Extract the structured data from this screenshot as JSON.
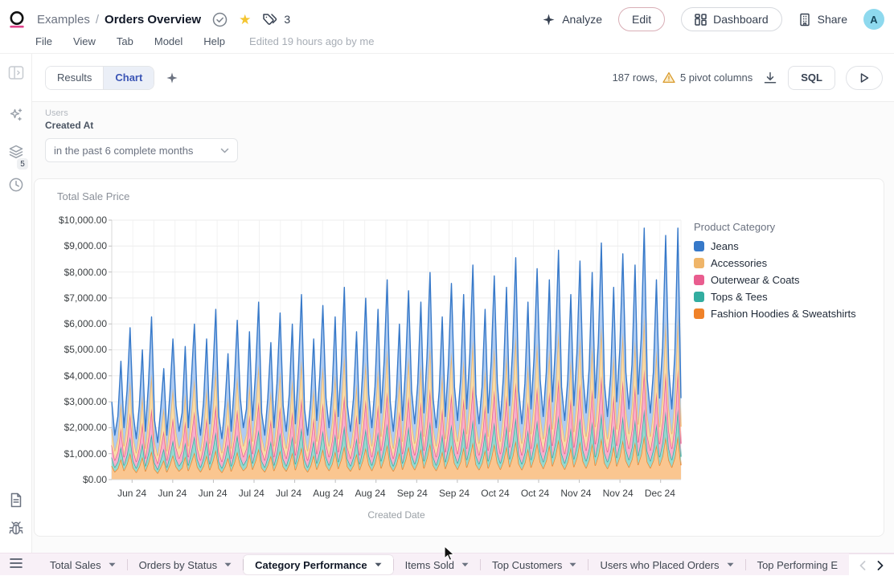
{
  "header": {
    "breadcrumb": {
      "parent": "Examples",
      "separator": "/",
      "title": "Orders Overview"
    },
    "star_glyph": "★",
    "tag_count": "3",
    "actions": {
      "analyze": "Analyze",
      "edit": "Edit",
      "dashboard": "Dashboard",
      "share": "Share"
    },
    "avatar_letter": "A",
    "menus": [
      "File",
      "View",
      "Tab",
      "Model",
      "Help"
    ],
    "edited_note": "Edited 19 hours ago by me"
  },
  "sidebar": {
    "layers_badge": "5"
  },
  "toolbar": {
    "view_tabs": [
      {
        "label": "Results"
      },
      {
        "label": "Chart"
      }
    ],
    "rows_info": "187 rows,",
    "pivot_info": "5 pivot columns",
    "sql_label": "SQL"
  },
  "filter": {
    "group": "Users",
    "field": "Created At",
    "value": "in the past 6 complete months"
  },
  "chart_data": {
    "type": "area",
    "stacked": true,
    "title": "Total Sale Price",
    "xlabel": "Created Date",
    "legend_title": "Product Category",
    "legend_position": "right",
    "grid": true,
    "ylim": [
      0,
      10000
    ],
    "y_tick_step": 1000,
    "y_tick_labels": [
      "$0.00",
      "$1,000.00",
      "$2,000.00",
      "$3,000.00",
      "$4,000.00",
      "$5,000.00",
      "$6,000.00",
      "$7,000.00",
      "$8,000.00",
      "$9,000.00",
      "$10,000.00"
    ],
    "x_tick_labels": [
      "Jun 24",
      "Jun 24",
      "Jun 24",
      "Jul 24",
      "Jul 24",
      "Aug 24",
      "Aug 24",
      "Sep 24",
      "Sep 24",
      "Oct 24",
      "Oct 24",
      "Nov 24",
      "Nov 24",
      "Dec 24"
    ],
    "points": 187,
    "stack_order_bottom_to_top": [
      "Fashion Hoodies & Sweatshirts",
      "Tops & Tees",
      "Outerwear & Coats",
      "Accessories",
      "Jeans"
    ],
    "series": [
      {
        "name": "Jeans",
        "color": "#3779C9",
        "fill": "#AECBF1",
        "values": [
          1050,
          600,
          850,
          1600,
          700,
          1200,
          2050,
          900,
          550,
          1000,
          1750,
          650,
          1300,
          2200,
          800,
          500,
          950,
          1500,
          600,
          1150,
          1900,
          1000,
          650,
          900,
          1800,
          700,
          1350,
          2100,
          950,
          600,
          1050,
          1900,
          750,
          1400,
          2300,
          850,
          550,
          1000,
          1700,
          650,
          1250,
          2150,
          1100,
          700,
          950,
          2000,
          800,
          1450,
          2400,
          900,
          600,
          1100,
          1850,
          700,
          1300,
          2250,
          1000,
          650,
          1150,
          2100,
          750,
          1500,
          2500,
          950,
          600,
          1050,
          1900,
          800,
          1400,
          2350,
          1100,
          700,
          1200,
          2200,
          850,
          1550,
          2600,
          1000,
          650,
          1100,
          2000,
          750,
          1450,
          2450,
          1150,
          700,
          1250,
          2300,
          900,
          1600,
          2700,
          1050,
          650,
          1150,
          2100,
          800,
          1500,
          2550,
          1200,
          750,
          1300,
          2400,
          900,
          1650,
          2800,
          1100,
          700,
          1200,
          2200,
          850,
          1550,
          2650,
          1250,
          800,
          1350,
          2500,
          950,
          1700,
          2900,
          1150,
          750,
          1250,
          2300,
          900,
          1600,
          2750,
          1300,
          800,
          1400,
          2600,
          1000,
          1750,
          3000,
          1200,
          750,
          1300,
          2400,
          950,
          1650,
          2850,
          1350,
          850,
          1450,
          2700,
          1050,
          1800,
          3100,
          1250,
          800,
          1350,
          2500,
          1000,
          1700,
          2950,
          1400,
          900,
          1500,
          2800,
          1100,
          1850,
          3200,
          1300,
          850,
          1400,
          2600,
          1050,
          1750,
          3050,
          1450,
          950,
          1550,
          2900,
          1150,
          1900,
          3400,
          1350,
          900,
          1450,
          2700,
          1100,
          1800,
          3300,
          1500,
          950,
          1700,
          3400,
          1100
        ]
      },
      {
        "name": "Accessories",
        "color": "#EFB569",
        "fill": "#F8DCA8",
        "values": [
          630,
          360,
          510,
          960,
          420,
          720,
          1230,
          540,
          330,
          600,
          1050,
          390,
          780,
          1320,
          480,
          300,
          570,
          900,
          360,
          690,
          1140,
          600,
          390,
          540,
          1080,
          420,
          810,
          1260,
          570,
          360,
          630,
          1140,
          450,
          840,
          1380,
          510,
          330,
          600,
          1020,
          390,
          750,
          1290,
          660,
          420,
          570,
          1200,
          480,
          870,
          1440,
          540,
          360,
          660,
          1110,
          420,
          780,
          1350,
          600,
          390,
          690,
          1260,
          450,
          900,
          1500,
          570,
          360,
          630,
          1140,
          480,
          840,
          1410,
          660,
          420,
          720,
          1320,
          510,
          930,
          1560,
          600,
          390,
          660,
          1200,
          450,
          870,
          1470,
          690,
          420,
          750,
          1380,
          540,
          960,
          1620,
          630,
          390,
          690,
          1260,
          480,
          900,
          1530,
          720,
          450,
          780,
          1440,
          540,
          990,
          1680,
          660,
          420,
          720,
          1320,
          510,
          930,
          1590,
          750,
          480,
          810,
          1500,
          570,
          1020,
          1740,
          690,
          450,
          750,
          1380,
          540,
          960,
          1650,
          780,
          480,
          840,
          1560,
          600,
          1050,
          1800,
          720,
          450,
          780,
          1440,
          570,
          990,
          1710,
          810,
          510,
          870,
          1620,
          630,
          1080,
          1860,
          750,
          480,
          810,
          1500,
          600,
          1020,
          1770,
          840,
          540,
          900,
          1680,
          660,
          1110,
          1920,
          780,
          510,
          840,
          1560,
          630,
          1050,
          1830,
          870,
          570,
          930,
          1740,
          690,
          1140,
          2040,
          810,
          540,
          870,
          1620,
          660,
          1080,
          1980,
          900,
          570,
          1020,
          2040,
          660
        ]
      },
      {
        "name": "Outerwear & Coats",
        "color": "#E95D8F",
        "fill": "#F8AECB",
        "values": [
          470,
          270,
          380,
          720,
          320,
          540,
          920,
          400,
          250,
          450,
          790,
          290,
          590,
          990,
          360,
          230,
          430,
          680,
          270,
          520,
          860,
          450,
          290,
          410,
          810,
          320,
          610,
          950,
          430,
          270,
          470,
          860,
          340,
          630,
          1040,
          380,
          250,
          450,
          770,
          290,
          560,
          970,
          500,
          320,
          430,
          900,
          360,
          650,
          1080,
          410,
          270,
          500,
          830,
          320,
          590,
          1010,
          450,
          290,
          520,
          950,
          340,
          680,
          1130,
          430,
          270,
          470,
          860,
          360,
          630,
          1060,
          500,
          320,
          540,
          990,
          380,
          700,
          1170,
          450,
          290,
          500,
          900,
          340,
          650,
          1100,
          520,
          320,
          560,
          1040,
          410,
          720,
          1220,
          470,
          290,
          520,
          950,
          360,
          680,
          1150,
          540,
          340,
          590,
          1080,
          410,
          740,
          1260,
          500,
          320,
          540,
          990,
          380,
          700,
          1190,
          560,
          360,
          610,
          1130,
          430,
          770,
          1310,
          520,
          340,
          560,
          1040,
          410,
          720,
          1240,
          590,
          360,
          630,
          1170,
          450,
          790,
          1350,
          540,
          340,
          590,
          1080,
          430,
          740,
          1280,
          610,
          380,
          650,
          1220,
          470,
          810,
          1400,
          560,
          360,
          610,
          1130,
          450,
          770,
          1330,
          630,
          410,
          680,
          1260,
          500,
          830,
          1440,
          590,
          380,
          630,
          1170,
          470,
          790,
          1370,
          650,
          430,
          700,
          1310,
          520,
          860,
          1530,
          610,
          410,
          650,
          1220,
          500,
          810,
          1490,
          680,
          430,
          770,
          1530,
          500
        ]
      },
      {
        "name": "Tops & Tees",
        "color": "#33ADA0",
        "fill": "#96D8CE",
        "values": [
          320,
          180,
          260,
          480,
          210,
          360,
          620,
          270,
          170,
          300,
          530,
          200,
          390,
          660,
          240,
          150,
          290,
          450,
          180,
          350,
          570,
          300,
          200,
          270,
          540,
          210,
          410,
          630,
          290,
          180,
          320,
          570,
          230,
          420,
          690,
          260,
          170,
          300,
          510,
          200,
          380,
          650,
          330,
          210,
          290,
          600,
          240,
          440,
          720,
          270,
          180,
          330,
          560,
          210,
          390,
          680,
          300,
          200,
          350,
          630,
          230,
          450,
          750,
          290,
          180,
          320,
          570,
          240,
          420,
          710,
          330,
          210,
          360,
          660,
          260,
          470,
          780,
          300,
          200,
          330,
          600,
          230,
          440,
          740,
          350,
          210,
          380,
          690,
          270,
          480,
          810,
          320,
          200,
          350,
          630,
          240,
          450,
          770,
          360,
          230,
          390,
          720,
          270,
          500,
          840,
          330,
          210,
          360,
          660,
          260,
          470,
          800,
          380,
          240,
          410,
          750,
          290,
          510,
          870,
          350,
          230,
          380,
          690,
          270,
          480,
          830,
          390,
          240,
          420,
          780,
          300,
          530,
          900,
          360,
          230,
          390,
          720,
          290,
          500,
          860,
          410,
          260,
          440,
          810,
          320,
          540,
          930,
          380,
          240,
          410,
          750,
          300,
          510,
          890,
          420,
          270,
          450,
          840,
          330,
          560,
          960,
          390,
          260,
          420,
          780,
          320,
          530,
          920,
          440,
          290,
          470,
          870,
          350,
          570,
          1020,
          410,
          270,
          440,
          810,
          330,
          540,
          990,
          450,
          290,
          510,
          1020,
          330
        ]
      },
      {
        "name": "Fashion Hoodies & Sweatshirts",
        "color": "#F08229",
        "fill": "#FAC690",
        "values": [
          530,
          300,
          430,
          800,
          350,
          600,
          1030,
          450,
          280,
          500,
          880,
          330,
          650,
          1100,
          400,
          250,
          480,
          750,
          300,
          580,
          950,
          500,
          330,
          450,
          900,
          350,
          680,
          1050,
          480,
          300,
          530,
          950,
          380,
          700,
          1150,
          430,
          280,
          500,
          850,
          330,
          630,
          1080,
          550,
          350,
          480,
          1000,
          400,
          730,
          1200,
          450,
          300,
          550,
          930,
          350,
          650,
          1130,
          500,
          330,
          580,
          1050,
          380,
          750,
          1250,
          480,
          300,
          530,
          950,
          400,
          700,
          1180,
          550,
          350,
          600,
          1100,
          430,
          780,
          1300,
          500,
          330,
          550,
          1000,
          380,
          730,
          1230,
          580,
          350,
          630,
          1150,
          450,
          800,
          1350,
          530,
          330,
          580,
          1050,
          400,
          750,
          1280,
          600,
          380,
          650,
          1200,
          450,
          830,
          1400,
          550,
          350,
          600,
          1100,
          430,
          780,
          1330,
          630,
          400,
          680,
          1250,
          480,
          850,
          1450,
          580,
          380,
          630,
          1150,
          450,
          800,
          1380,
          650,
          400,
          700,
          1300,
          500,
          880,
          1500,
          600,
          380,
          650,
          1200,
          480,
          830,
          1430,
          680,
          430,
          730,
          1350,
          530,
          900,
          1550,
          630,
          400,
          680,
          1250,
          500,
          850,
          1480,
          700,
          450,
          750,
          1400,
          550,
          930,
          1600,
          650,
          430,
          700,
          1300,
          530,
          880,
          1530,
          730,
          480,
          780,
          1450,
          580,
          950,
          1700,
          680,
          450,
          730,
          1350,
          550,
          900,
          1650,
          750,
          480,
          850,
          1700,
          550
        ]
      }
    ]
  },
  "tabs": {
    "items": [
      {
        "label": "Total Sales",
        "active": false
      },
      {
        "label": "Orders by Status",
        "active": false
      },
      {
        "label": "Category Performance",
        "active": true
      },
      {
        "label": "Items Sold",
        "active": false
      },
      {
        "label": "Top Customers",
        "active": false
      },
      {
        "label": "Users who Placed Orders",
        "active": false
      },
      {
        "label": "Top Performing E",
        "active": false
      }
    ]
  }
}
